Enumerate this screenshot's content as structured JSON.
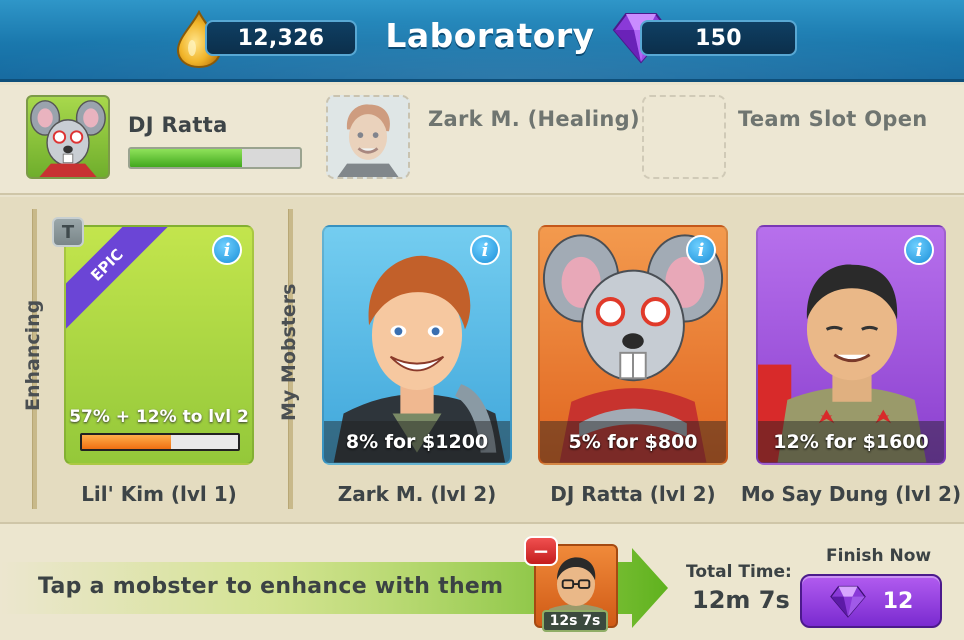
{
  "header": {
    "title": "Laboratory",
    "oil_amount": "12,326",
    "gem_amount": "150",
    "icons": {
      "oil": "oil-drop-icon",
      "gem": "purple-gem-icon"
    }
  },
  "team": {
    "slots": [
      {
        "name": "DJ Ratta",
        "health": 0.66
      },
      {
        "name": "Zark M.  (Healing)"
      },
      {
        "name": "Team Slot Open"
      }
    ]
  },
  "enhancing": {
    "section_label": "Enhancing",
    "badge": "T",
    "rarity": "EPIC",
    "progress_text": "57% + 12% to lvl 2",
    "progress": 0.57,
    "caption": "Lil' Kim (lvl 1)"
  },
  "my_mobsters": {
    "section_label": "My Mobsters",
    "cards": [
      {
        "footer": "8% for $1200",
        "caption": "Zark M. (lvl 2)",
        "bg": "#5fbde6"
      },
      {
        "footer": "5% for $800",
        "caption": "DJ Ratta (lvl 2)",
        "bg": "#ee7a2e"
      },
      {
        "footer": "12% for $1600",
        "caption": "Mo Say Dung (lvl 2)",
        "bg": "#9b55d6"
      }
    ]
  },
  "queue": {
    "hint": "Tap a mobster to enhance with them",
    "timer": "12s 7s",
    "remove_label": "−"
  },
  "total": {
    "label": "Total Time:",
    "value": "12m 7s"
  },
  "finish": {
    "label": "Finish Now",
    "cost": "12"
  },
  "colors": {
    "accent_blue": "#1a78ad",
    "gem_purple": "#8a3ad8",
    "health_green": "#42a81e",
    "progress_orange": "#f07012"
  }
}
